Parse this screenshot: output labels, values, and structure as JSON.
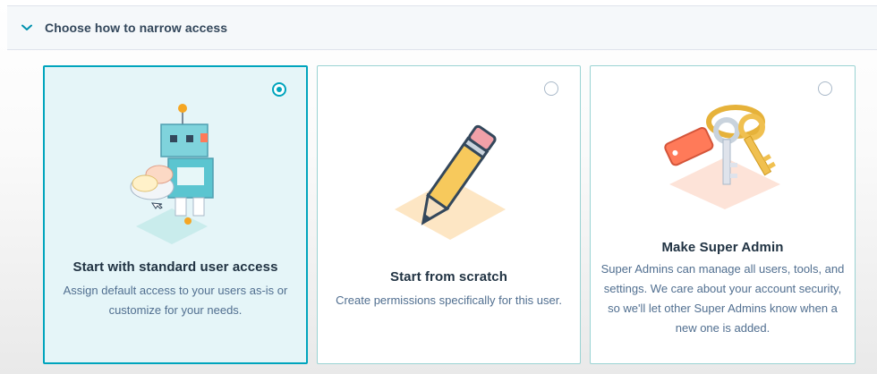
{
  "section": {
    "title": "Choose how to narrow access",
    "chevron_icon": "chevron-down-icon"
  },
  "options": [
    {
      "title": "Start with standard user access",
      "description": "Assign default access to your users as-is or customize for your needs.",
      "selected": true,
      "illustration": "robot-illustration"
    },
    {
      "title": "Start from scratch",
      "description": "Create permissions specifically for this user.",
      "selected": false,
      "illustration": "pencil-illustration"
    },
    {
      "title": "Make Super Admin",
      "description": "Super Admins can manage all users, tools, and settings. We care about your account security, so we'll let other Super Admins know when a new one is added.",
      "selected": false,
      "illustration": "keys-illustration"
    }
  ],
  "colors": {
    "accent": "#00a4bd",
    "selected_bg": "#e5f5f8",
    "card_border": "#9ad3d3",
    "title_text": "#213343",
    "body_text": "#516f90"
  }
}
